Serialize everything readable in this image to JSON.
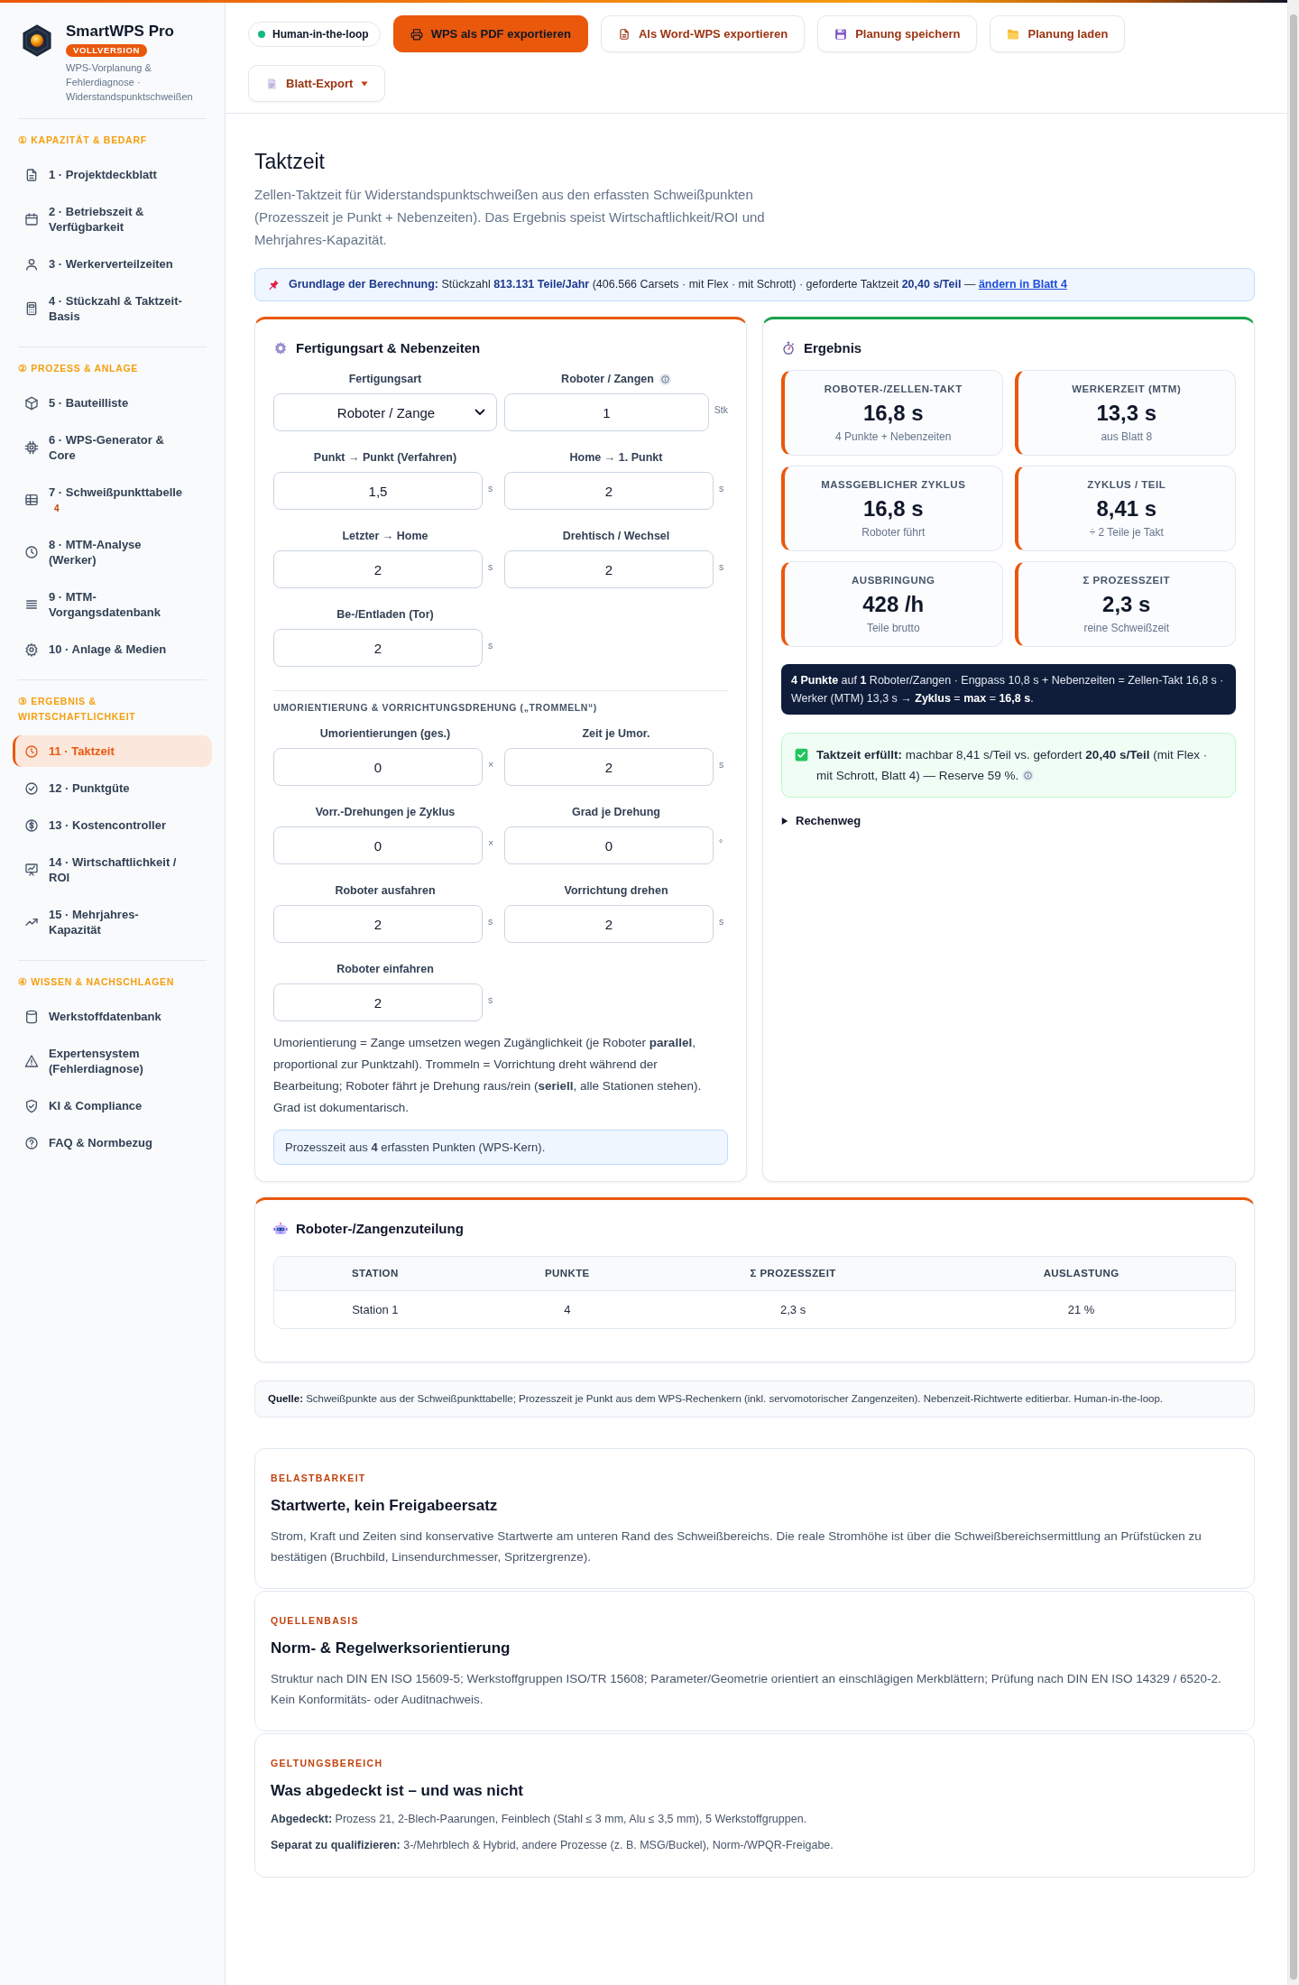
{
  "sidebar": {
    "brand": {
      "name": "SmartWPS Pro",
      "badge": "VOLLVERSION",
      "subtitle": "WPS-Vorplanung & Fehlerdiagnose · Widerstandspunktschweißen"
    },
    "groups": [
      {
        "heading": "① KAPAZITÄT & BEDARF",
        "items": [
          {
            "label": "1 · Projektdeckblatt",
            "selected": false
          },
          {
            "label": "2 · Betriebszeit & Verfügbarkeit",
            "selected": false
          },
          {
            "label": "3 · Werkerverteilzeiten",
            "selected": false
          },
          {
            "label": "4 · Stückzahl & Taktzeit-Basis",
            "selected": false
          }
        ]
      },
      {
        "heading": "② PROZESS & ANLAGE",
        "items": [
          {
            "label": "5 · Bauteilliste",
            "selected": false
          },
          {
            "label": "6 · WPS-Generator & Core",
            "selected": false
          },
          {
            "label": "7 · Schweißpunkttabelle",
            "selected": false,
            "count": "4"
          },
          {
            "label": "8 · MTM-Analyse (Werker)",
            "selected": false
          },
          {
            "label": "9 · MTM-Vorgangsdatenbank",
            "selected": false
          },
          {
            "label": "10 · Anlage & Medien",
            "selected": false
          }
        ]
      },
      {
        "heading": "③ ERGEBNIS & WIRTSCHAFTLICHKEIT",
        "items": [
          {
            "label": "11 · Taktzeit",
            "selected": true
          },
          {
            "label": "12 · Punktgüte",
            "selected": false
          },
          {
            "label": "13 · Kostencontroller",
            "selected": false
          },
          {
            "label": "14 · Wirtschaftlichkeit / ROI",
            "selected": false
          },
          {
            "label": "15 · Mehrjahres-Kapazität",
            "selected": false
          }
        ]
      },
      {
        "heading": "④ WISSEN & NACHSCHLAGEN",
        "items": [
          {
            "label": "Werkstoffdatenbank",
            "selected": false
          },
          {
            "label": "Expertensystem (Fehlerdiagnose)",
            "selected": false
          },
          {
            "label": "KI & Compliance",
            "selected": false
          },
          {
            "label": "FAQ & Normbezug",
            "selected": false
          }
        ]
      }
    ]
  },
  "toolbar": {
    "status": {
      "label": "Human-in-the-loop"
    },
    "buttons": [
      {
        "label": "WPS als PDF exportieren",
        "kind": "primary"
      },
      {
        "label": "Als Word-WPS exportieren",
        "kind": "secondary"
      },
      {
        "label": "Planung speichern",
        "kind": "secondary"
      },
      {
        "label": "Planung laden",
        "kind": "secondary"
      },
      {
        "label": "Blatt-Export",
        "kind": "menu"
      }
    ]
  },
  "page": {
    "title": "Taktzeit",
    "description": "Zellen-Taktzeit für Widerstandspunktschweißen aus den erfassten Schweißpunkten (Prozesszeit je Punkt + Nebenzeiten). Das Ergebnis speist Wirtschaftlichkeit/ROI und Mehrjahres-Kapazität."
  },
  "basis_banner": {
    "text": "**Grundlage der Berechnung:** Stückzahl **813.131 Teile/Jahr** (406.566 Carsets · mit Flex · mit Schrott) · geforderte Taktzeit **20,40 s/Teil** —",
    "link": "ändern in Blatt 4"
  },
  "production_panel": {
    "title": "Fertigungsart & Nebenzeiten",
    "fields": [
      {
        "label": "Fertigungsart",
        "kind": "select",
        "value": "Roboter / Zange"
      },
      {
        "label": "Roboter / Zangen",
        "kind": "number",
        "value": "1",
        "unit": "Stk",
        "info": true
      },
      {
        "label": "Punkt → Punkt (Verfahren)",
        "kind": "number",
        "value": "1,5",
        "unit": "s"
      },
      {
        "label": "Home → 1. Punkt",
        "kind": "number",
        "value": "2",
        "unit": "s"
      },
      {
        "label": "Letzter → Home",
        "kind": "number",
        "value": "2",
        "unit": "s"
      },
      {
        "label": "Drehtisch / Wechsel",
        "kind": "number",
        "value": "2",
        "unit": "s"
      },
      {
        "label": "Be-/Entladen (Tor)",
        "kind": "number",
        "value": "2",
        "unit": "s"
      }
    ],
    "section": {
      "heading": "UMORIENTIERUNG & VORRICHTUNGSDREHUNG („TROMMELN“)",
      "fields": [
        {
          "label": "Umorientierungen (ges.)",
          "kind": "number",
          "value": "0",
          "unit": "×"
        },
        {
          "label": "Zeit je Umor.",
          "kind": "number",
          "value": "2",
          "unit": "s"
        },
        {
          "label": "Vorr.-Drehungen je Zyklus",
          "kind": "number",
          "value": "0",
          "unit": "×"
        },
        {
          "label": "Grad je Drehung",
          "kind": "number",
          "value": "0",
          "unit": "°"
        },
        {
          "label": "Roboter ausfahren",
          "kind": "number",
          "value": "2",
          "unit": "s"
        },
        {
          "label": "Vorrichtung drehen",
          "kind": "number",
          "value": "2",
          "unit": "s"
        },
        {
          "label": "Roboter einfahren",
          "kind": "number",
          "value": "2",
          "unit": "s"
        }
      ]
    },
    "note": "Umorientierung = Zange umsetzen wegen Zugänglichkeit (je Roboter **parallel**, proportional zur Punktzahl). Trommeln = Vorrichtung dreht während der Bearbeitung; Roboter fährt je Drehung raus/rein (**seriell**, alle Stationen stehen). Grad ist dokumentarisch.",
    "process_note": "Prozesszeit aus **4** erfassten Punkten (WPS-Kern)."
  },
  "result_panel": {
    "title": "Ergebnis",
    "kpis": [
      {
        "label": "ROBOTER-/ZELLEN-TAKT",
        "value": "16,8 s",
        "caption": "4 Punkte + Nebenzeiten"
      },
      {
        "label": "WERKERZEIT (MTM)",
        "value": "13,3 s",
        "caption": "aus Blatt 8"
      },
      {
        "label": "MASSGEBLICHER ZYKLUS",
        "value": "16,8 s",
        "caption": "Roboter führt"
      },
      {
        "label": "ZYKLUS / TEIL",
        "value": "8,41 s",
        "caption": "÷ 2 Teile je Takt"
      },
      {
        "label": "AUSBRINGUNG",
        "value": "428 /h",
        "caption": "Teile brutto"
      },
      {
        "label": "Σ PROZESSZEIT",
        "value": "2,3 s",
        "caption": "reine Schweißzeit"
      }
    ],
    "summary": "**4 Punkte** auf **1** Roboter/Zangen · Engpass 10,8 s + Nebenzeiten = Zellen-Takt 16,8 s · Werker (MTM) 13,3 s → **Zyklus** = **max** = **16,8 s**.",
    "check": {
      "met": true,
      "text": "**Taktzeit erfüllt:** machbar 8,41 s/Teil vs. gefordert **20,40 s/Teil** (mit Flex · mit Schrott, Blatt 4) — Reserve 59 %."
    },
    "details": {
      "label": "Rechenweg",
      "expanded": false
    }
  },
  "allocation_panel": {
    "title": "Roboter-/Zangenzuteilung",
    "table": {
      "columns": [
        "STATION",
        "PUNKTE",
        "Σ PROZESSZEIT",
        "AUSLASTUNG"
      ],
      "rows": [
        [
          "Station 1",
          "4",
          "2,3 s",
          "21 %"
        ]
      ]
    }
  },
  "source_note": "**Quelle:** Schweißpunkte aus der Schweißpunkttabelle; Prozesszeit je Punkt aus dem WPS-Rechenkern (inkl. servomotorischer Zangenzeiten). Nebenzeit-Richtwerte editierbar. Human-in-the-loop.",
  "info_cards": [
    {
      "eyebrow": "BELASTBARKEIT",
      "title": "Startwerte, kein Freigabeersatz",
      "paragraphs": [
        "Strom, Kraft und Zeiten sind konservative Startwerte am unteren Rand des Schweißbereichs. Die reale Stromhöhe ist über die Schweißbereichsermittlung an Prüfstücken zu bestätigen (Bruchbild, Linsendurchmesser, Spritzergrenze)."
      ]
    },
    {
      "eyebrow": "QUELLENBASIS",
      "title": "Norm- & Regelwerksorientierung",
      "paragraphs": [
        "Struktur nach DIN EN ISO 15609-5; Werkstoffgruppen ISO/TR 15608; Parameter/Geometrie orientiert an einschlägigen Merkblättern; Prüfung nach DIN EN ISO 14329 / 6520-2. Kein Konformitäts- oder Auditnachweis."
      ]
    },
    {
      "eyebrow": "GELTUNGSBEREICH",
      "title": "Was abgedeckt ist – und was nicht",
      "paragraphs": [
        "**Abgedeckt:** Prozess 21, 2-Blech-Paarungen, Feinblech (Stahl ≤ 3 mm, Alu ≤ 3,5 mm), 5 Werkstoffgruppen.",
        "**Separat zu qualifizieren:** 3-/Mehrblech & Hybrid, andere Prozesse (z. B. MSG/Buckel), Norm-/WPQR-Freigabe."
      ]
    }
  ]
}
